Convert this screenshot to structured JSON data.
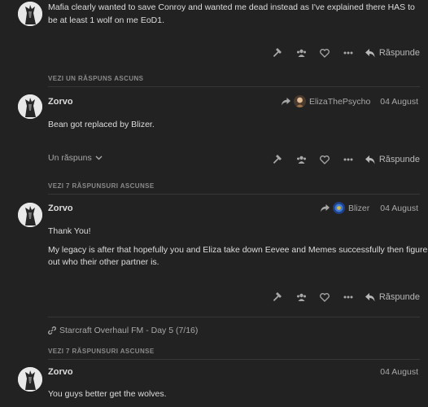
{
  "post0": {
    "text": "Mafia clearly wanted to save Conroy and wanted me dead instead as I've explained there HAS to be at least 1 wolf on me EoD1.",
    "reply_label": "Răspunde"
  },
  "hidden1": {
    "label": "VEZI UN RĂSPUNS ASCUNS"
  },
  "post1": {
    "username": "Zorvo",
    "reply_to": "ElizaThePsycho",
    "date": "04 August",
    "text": "Bean got replaced by Blizer.",
    "replies_toggle": "Un răspuns",
    "reply_label": "Răspunde"
  },
  "hidden2": {
    "label": "VEZI 7 RĂSPUNSURI ASCUNSE"
  },
  "post2": {
    "username": "Zorvo",
    "reply_to": "Blizer",
    "date": "04 August",
    "paragraphs": [
      "Thank You!",
      "My legacy is after that hopefully you and Eliza take down Eevee and Memes successfully then figure",
      "out who their other partner is."
    ],
    "reply_label": "Răspunde"
  },
  "topic_link": {
    "label": "Starcraft Overhaul FM - Day 5 (7/16)"
  },
  "hidden3": {
    "label": "VEZI 7 RĂSPUNSURI ASCUNSE"
  },
  "post3": {
    "username": "Zorvo",
    "date": "04 August",
    "text": "You guys better get the wolves."
  },
  "colors": {
    "background": "#222222",
    "text": "#dddddd",
    "muted": "#a8a8a8",
    "divider": "#363636"
  }
}
